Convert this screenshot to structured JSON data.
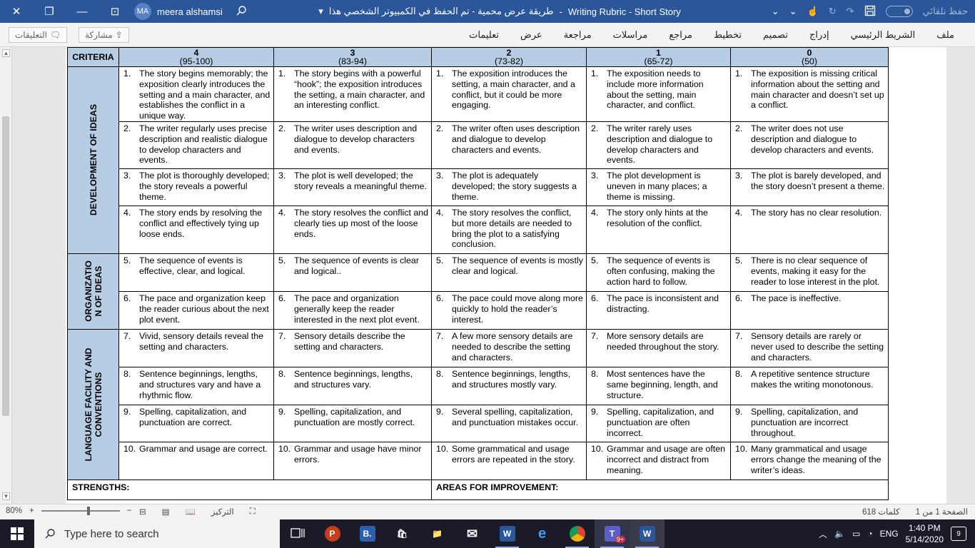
{
  "window": {
    "close_glyph": "✕",
    "restore_glyph": "❐",
    "minimize_glyph": "—",
    "tablet_glyph": "⊡"
  },
  "user": {
    "initials": "MA",
    "name": "meera alshamsi"
  },
  "document": {
    "title": "Writing Rubric - Short Story",
    "separator": "-",
    "save_status": "طريقة عرض محمية - تم الحفظ في الكمبيوتر الشخصي هذا",
    "autosave_label": "حفظ تلقائي"
  },
  "ribbon": {
    "tabs": [
      "ملف",
      "الشريط الرئيسي",
      "إدراج",
      "تصميم",
      "تخطيط",
      "مراجع",
      "مراسلات",
      "مراجعة",
      "عرض",
      "تعليمات"
    ],
    "comments_label": "التعليقات",
    "share_label": "مشاركة"
  },
  "rubric": {
    "criteria_label": "CRITERIA",
    "levels": [
      {
        "score": "4",
        "range": "(95-100)"
      },
      {
        "score": "3",
        "range": "(83-94)"
      },
      {
        "score": "2",
        "range": "(73-82)"
      },
      {
        "score": "1",
        "range": "(65-72)"
      },
      {
        "score": "0",
        "range": "(50)"
      }
    ],
    "categories": [
      {
        "name": "DEVELOPMENT OF IDEAS",
        "lines": [
          "DEVELOPMENT OF IDEAS"
        ]
      },
      {
        "name": "ORGANIZATION OF IDEAS",
        "lines": [
          "ORGANIZATIO",
          "N OF IDEAS"
        ]
      },
      {
        "name": "LANGUAGE FACILITY AND CONVENTIONS",
        "lines": [
          "LANGUAGE FACILITY AND",
          "CONVENTIONS"
        ]
      }
    ],
    "rows": [
      {
        "n": "1.",
        "cells": [
          "The story begins memorably; the exposition clearly introduces the setting and a main character, and establishes the conflict in a unique way.",
          "The story begins with a powerful “hook”; the exposition introduces the setting, a main character, and an interesting conflict.",
          "The exposition introduces the setting, a main character, and a conflict, but it could be more engaging.",
          "The exposition needs to include more information about the setting, main character, and conflict.",
          "The exposition is missing critical information about the setting and main character and doesn’t set up a conflict."
        ]
      },
      {
        "n": "2.",
        "cells": [
          "The writer regularly uses precise description and realistic dialogue to develop characters and events.",
          "The writer uses description and dialogue to develop characters and events.",
          "The writer often uses description and dialogue to develop characters and events.",
          "The writer rarely uses description and dialogue to develop characters and events.",
          "The writer does not use description and dialogue to develop characters and events."
        ]
      },
      {
        "n": "3.",
        "cells": [
          "The plot is thoroughly developed; the story reveals a powerful theme.",
          "The plot is well developed; the story reveals a meaningful theme.",
          "The plot is adequately developed; the story suggests a theme.",
          "The plot development is uneven in many places; a theme is missing.",
          "The plot is barely developed, and the story doesn’t present a theme."
        ]
      },
      {
        "n": "4.",
        "cells": [
          "The story ends by resolving the conflict and effectively tying up loose ends.",
          "The story resolves the conflict and clearly ties up most of the loose ends.",
          "The story resolves the conflict, but more details are needed to bring the plot to a satisfying conclusion.",
          "The story only hints at the resolution of the conflict.",
          "The story has no clear resolution."
        ]
      },
      {
        "n": "5.",
        "cells": [
          "The sequence of events is effective, clear, and logical.",
          "The sequence of events is clear and logical..",
          "The sequence of events is mostly clear and logical.",
          "The sequence of events is often confusing, making the action hard to follow.",
          "There is no clear sequence of events, making it easy for the reader to lose interest in the plot."
        ]
      },
      {
        "n": "6.",
        "cells": [
          "The pace and organization keep the reader curious about the next plot event.",
          "The pace and organization generally keep the reader interested in the next plot event.",
          "The pace could move along more quickly to hold the reader’s interest.",
          "The pace is inconsistent and distracting.",
          "The pace is ineffective."
        ]
      },
      {
        "n": "7.",
        "cells": [
          "Vivid, sensory details reveal the setting and characters.",
          "Sensory details describe the setting and characters.",
          "A few more sensory details are needed to describe the setting and characters.",
          "More sensory details are needed throughout the story.",
          "Sensory details are rarely or never used to describe the setting and characters."
        ]
      },
      {
        "n": "8.",
        "cells": [
          "Sentence beginnings, lengths, and structures vary and have a rhythmic flow.",
          "Sentence beginnings, lengths, and structures vary.",
          "Sentence beginnings, lengths, and structures mostly vary.",
          "Most sentences have the same beginning, length, and structure.",
          "A repetitive sentence structure makes the writing monotonous."
        ]
      },
      {
        "n": "9.",
        "cells": [
          "Spelling, capitalization, and punctuation are correct.",
          "Spelling, capitalization, and punctuation are mostly correct.",
          "Several spelling, capitalization, and punctuation mistakes occur.",
          "Spelling, capitalization, and punctuation are often incorrect.",
          "Spelling, capitalization, and punctuation are incorrect throughout."
        ]
      },
      {
        "n": "10.",
        "cells": [
          "Grammar and usage are correct.",
          "Grammar and usage have minor errors.",
          "Some grammatical and usage errors are repeated in the story.",
          "Grammar and usage are often incorrect and distract from meaning.",
          "Many grammatical and usage errors change the meaning of the writer’s ideas."
        ]
      }
    ],
    "strengths_label": "STRENGTHS:",
    "improvement_label": "AREAS FOR IMPROVEMENT:"
  },
  "statusbar": {
    "zoom": "80%",
    "zoom_in": "+",
    "zoom_out": "−",
    "focus_label": "التركيز",
    "word_count": "618 كلمات",
    "page_info": "الصفحة 1 من 1"
  },
  "taskbar": {
    "search_placeholder": "Type here to search",
    "language": "ENG",
    "time": "1:40 PM",
    "date": "5/14/2020",
    "notification_count": "9",
    "teams_badge": "9+",
    "apps": [
      {
        "name": "task-view",
        "label": "",
        "color": "#1a1b26"
      },
      {
        "name": "powerpoint",
        "label": "P",
        "color": "#c43e1c"
      },
      {
        "name": "b-app",
        "label": "B.",
        "color": "#2b5fad"
      },
      {
        "name": "store",
        "label": "🛍",
        "color": "#1a1b26"
      },
      {
        "name": "file-explorer",
        "label": "📁",
        "color": "#1a1b26"
      },
      {
        "name": "mail",
        "label": "✉",
        "color": "#1a1b26"
      },
      {
        "name": "word",
        "label": "W",
        "color": "#2b579a"
      },
      {
        "name": "edge",
        "label": "e",
        "color": "#1a1b26"
      },
      {
        "name": "chrome",
        "label": "M",
        "color": "#1a1b26"
      },
      {
        "name": "teams",
        "label": "T",
        "color": "#5b5fc7"
      },
      {
        "name": "word-active",
        "label": "W",
        "color": "#2b579a"
      }
    ]
  }
}
